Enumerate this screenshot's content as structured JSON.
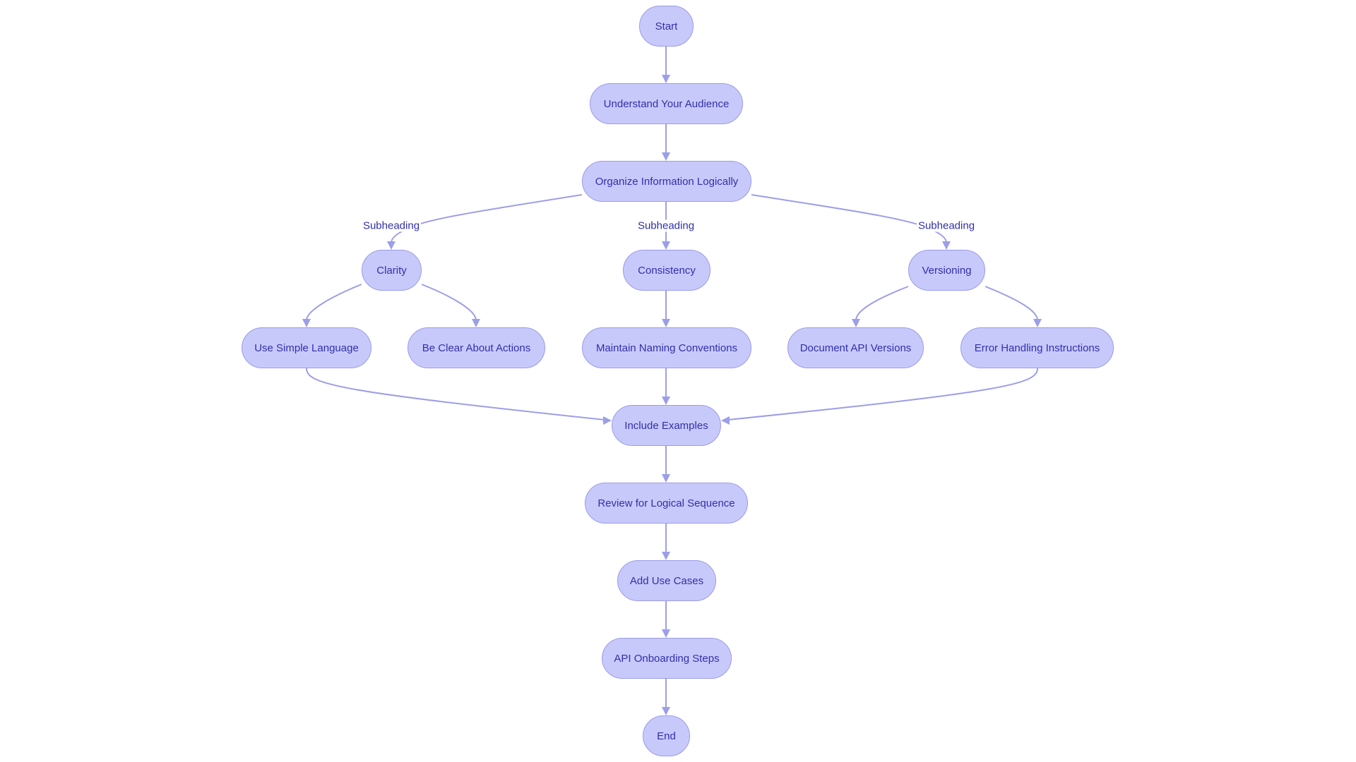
{
  "diagram": {
    "type": "flowchart",
    "colors": {
      "node_fill": "#c8c9fb",
      "node_border": "#9a9be6",
      "text": "#3030a8",
      "edge": "#9d9ee8"
    },
    "nodes": [
      {
        "id": "start",
        "label": "Start"
      },
      {
        "id": "understand",
        "label": "Understand Your Audience"
      },
      {
        "id": "organize",
        "label": "Organize Information Logically"
      },
      {
        "id": "clarity",
        "label": "Clarity"
      },
      {
        "id": "consistency",
        "label": "Consistency"
      },
      {
        "id": "versioning",
        "label": "Versioning"
      },
      {
        "id": "simple",
        "label": "Use Simple Language"
      },
      {
        "id": "clear",
        "label": "Be Clear About Actions"
      },
      {
        "id": "naming",
        "label": "Maintain Naming Conventions"
      },
      {
        "id": "docversions",
        "label": "Document API Versions"
      },
      {
        "id": "errors",
        "label": "Error Handling Instructions"
      },
      {
        "id": "examples",
        "label": "Include Examples"
      },
      {
        "id": "review",
        "label": "Review for Logical Sequence"
      },
      {
        "id": "usecases",
        "label": "Add Use Cases"
      },
      {
        "id": "onboarding",
        "label": "API Onboarding Steps"
      },
      {
        "id": "end",
        "label": "End"
      }
    ],
    "edges": [
      {
        "from": "start",
        "to": "understand",
        "label": ""
      },
      {
        "from": "understand",
        "to": "organize",
        "label": ""
      },
      {
        "from": "organize",
        "to": "clarity",
        "label": "Subheading"
      },
      {
        "from": "organize",
        "to": "consistency",
        "label": "Subheading"
      },
      {
        "from": "organize",
        "to": "versioning",
        "label": "Subheading"
      },
      {
        "from": "clarity",
        "to": "simple",
        "label": ""
      },
      {
        "from": "clarity",
        "to": "clear",
        "label": ""
      },
      {
        "from": "consistency",
        "to": "naming",
        "label": ""
      },
      {
        "from": "versioning",
        "to": "docversions",
        "label": ""
      },
      {
        "from": "versioning",
        "to": "errors",
        "label": ""
      },
      {
        "from": "simple",
        "to": "examples",
        "label": ""
      },
      {
        "from": "naming",
        "to": "examples",
        "label": ""
      },
      {
        "from": "errors",
        "to": "examples",
        "label": ""
      },
      {
        "from": "examples",
        "to": "review",
        "label": ""
      },
      {
        "from": "review",
        "to": "usecases",
        "label": ""
      },
      {
        "from": "usecases",
        "to": "onboarding",
        "label": ""
      },
      {
        "from": "onboarding",
        "to": "end",
        "label": ""
      }
    ]
  }
}
